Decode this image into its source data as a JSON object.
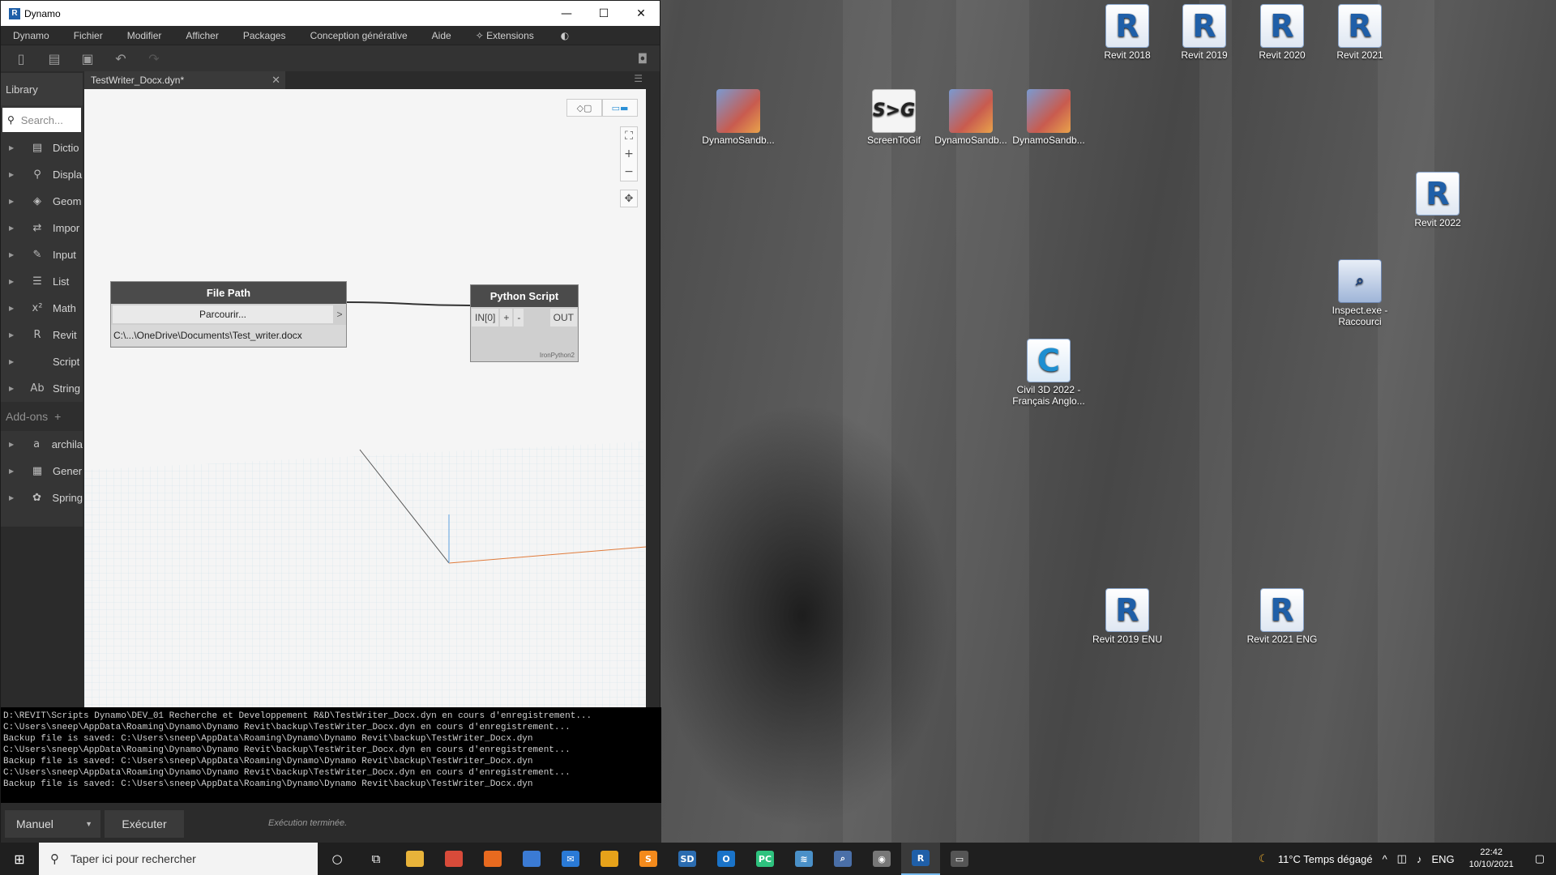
{
  "window": {
    "title": "Dynamo",
    "app_icon": "R",
    "menu": [
      "Dynamo",
      "Fichier",
      "Modifier",
      "Afficher",
      "Packages",
      "Conception générative",
      "Aide",
      "Extensions"
    ]
  },
  "library": {
    "header": "Library",
    "search_placeholder": "Search...",
    "items": [
      {
        "label": "Dictio",
        "icon": "dictionary-icon"
      },
      {
        "label": "Displa",
        "icon": "display-icon"
      },
      {
        "label": "Geom",
        "icon": "geometry-icon"
      },
      {
        "label": "Impor",
        "icon": "import-icon"
      },
      {
        "label": "Input",
        "icon": "input-icon"
      },
      {
        "label": "List",
        "icon": "list-icon"
      },
      {
        "label": "Math",
        "icon": "math-icon"
      },
      {
        "label": "Revit",
        "icon": "revit-icon"
      },
      {
        "label": "Script",
        "icon": "script-icon"
      },
      {
        "label": "String",
        "icon": "string-icon"
      }
    ],
    "addons_label": "Add-ons",
    "addons": [
      {
        "label": "archila",
        "icon": "archilab-icon"
      },
      {
        "label": "Gener",
        "icon": "generative-icon"
      },
      {
        "label": "Spring",
        "icon": "springs-icon"
      }
    ]
  },
  "workspace": {
    "tab_title": "TestWriter_Docx.dyn*",
    "nodes": {
      "file_path": {
        "title": "File Path",
        "browse": "Parcourir...",
        "out_port": ">",
        "value": "C:\\...\\OneDrive\\Documents\\Test_writer.docx"
      },
      "python": {
        "title": "Python Script",
        "in_port": "IN[0]",
        "add": "+",
        "remove": "-",
        "out_port": "OUT",
        "engine": "IronPython2"
      }
    }
  },
  "console": {
    "lines": [
      "D:\\REVIT\\Scripts Dynamo\\DEV_01 Recherche et Developpement R&D\\TestWriter_Docx.dyn en cours d'enregistrement...",
      "C:\\Users\\sneep\\AppData\\Roaming\\Dynamo\\Dynamo Revit\\backup\\TestWriter_Docx.dyn en cours d'enregistrement...",
      "Backup file is saved: C:\\Users\\sneep\\AppData\\Roaming\\Dynamo\\Dynamo Revit\\backup\\TestWriter_Docx.dyn",
      "C:\\Users\\sneep\\AppData\\Roaming\\Dynamo\\Dynamo Revit\\backup\\TestWriter_Docx.dyn en cours d'enregistrement...",
      "Backup file is saved: C:\\Users\\sneep\\AppData\\Roaming\\Dynamo\\Dynamo Revit\\backup\\TestWriter_Docx.dyn",
      "C:\\Users\\sneep\\AppData\\Roaming\\Dynamo\\Dynamo Revit\\backup\\TestWriter_Docx.dyn en cours d'enregistrement...",
      "Backup file is saved: C:\\Users\\sneep\\AppData\\Roaming\\Dynamo\\Dynamo Revit\\backup\\TestWriter_Docx.dyn"
    ]
  },
  "footer": {
    "run_mode": "Manuel",
    "run_button": "Exécuter",
    "status": "Exécution terminée."
  },
  "desktop": {
    "icons": [
      {
        "label": "Revit 2018",
        "kind": "revit",
        "glyph": "R"
      },
      {
        "label": "Revit 2019",
        "kind": "revit",
        "glyph": "R"
      },
      {
        "label": "Revit 2020",
        "kind": "revit",
        "glyph": "R"
      },
      {
        "label": "Revit 2021",
        "kind": "revit",
        "glyph": "R"
      },
      {
        "label": "DynamoSandb...",
        "kind": "dyn",
        "glyph": ""
      },
      {
        "label": "ScreenToGif",
        "kind": "gif",
        "glyph": "S>G"
      },
      {
        "label": "DynamoSandb...",
        "kind": "dyn",
        "glyph": ""
      },
      {
        "label": "DynamoSandb...",
        "kind": "dyn",
        "glyph": ""
      },
      {
        "label": "Revit 2022",
        "kind": "revit",
        "glyph": "R"
      },
      {
        "label": "Inspect.exe - Raccourci",
        "kind": "inspect",
        "glyph": "⌕"
      },
      {
        "label": "Civil 3D 2022 - Français Anglo...",
        "kind": "civil",
        "glyph": "C"
      },
      {
        "label": "Revit 2019 ENU",
        "kind": "revit",
        "glyph": "R"
      },
      {
        "label": "Revit 2021 ENG",
        "kind": "revit",
        "glyph": "R"
      }
    ]
  },
  "taskbar": {
    "search_placeholder": "Taper ici pour rechercher",
    "weather": "11°C  Temps dégagé",
    "language": "ENG",
    "time": "22:42",
    "date": "10/10/2021",
    "apps": [
      {
        "icon": "cortana-icon",
        "glyph": "○",
        "color": ""
      },
      {
        "icon": "task-view-icon",
        "glyph": "⧉",
        "color": ""
      },
      {
        "icon": "file-explorer-icon",
        "glyph": "",
        "color": "#e8b33a"
      },
      {
        "icon": "chrome-icon",
        "glyph": "",
        "color": "#d84b3a"
      },
      {
        "icon": "firefox-icon",
        "glyph": "",
        "color": "#e86a1f"
      },
      {
        "icon": "store-icon",
        "glyph": "",
        "color": "#3b7bd4"
      },
      {
        "icon": "mail-icon",
        "glyph": "✉",
        "color": "#2a7ad6"
      },
      {
        "icon": "notes-icon",
        "glyph": "",
        "color": "#e6a21a"
      },
      {
        "icon": "sublime-icon",
        "glyph": "S",
        "color": "#f38a1c"
      },
      {
        "icon": "sketchup-icon",
        "glyph": "SD",
        "color": "#2b6cb0"
      },
      {
        "icon": "outlook-icon",
        "glyph": "O",
        "color": "#1a73c8"
      },
      {
        "icon": "pycharm-icon",
        "glyph": "PC",
        "color": "#2ec27e"
      },
      {
        "icon": "ink-icon",
        "glyph": "≋",
        "color": "#4a90c8"
      },
      {
        "icon": "inspect-icon",
        "glyph": "⌕",
        "color": "#4a6fa8"
      },
      {
        "icon": "camera-icon",
        "glyph": "◉",
        "color": "#777"
      },
      {
        "icon": "revit-icon",
        "glyph": "R",
        "color": "#1f5fa8"
      },
      {
        "icon": "dynamo-monitor-icon",
        "glyph": "▭",
        "color": "#555"
      }
    ]
  }
}
